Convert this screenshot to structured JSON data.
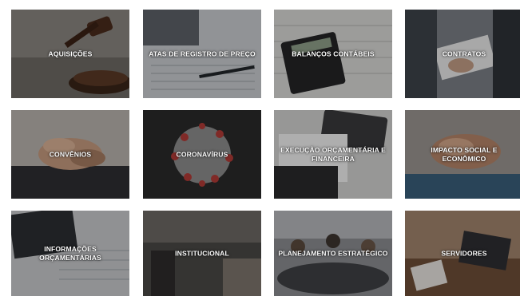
{
  "tiles": [
    {
      "label": "AQUISIÇÕES",
      "icon": "gavel-icon"
    },
    {
      "label": "ATAS DE REGISTRO DE PREÇO",
      "icon": "pen-icon"
    },
    {
      "label": "BALANÇOS CONTÁBEIS",
      "icon": "calculator-icon"
    },
    {
      "label": "CONTRATOS",
      "icon": "handshake-icon"
    },
    {
      "label": "CONVÊNIOS",
      "icon": "hands-icon"
    },
    {
      "label": "CORONAVÍRUS",
      "icon": "virus-icon"
    },
    {
      "label": "EXECUÇÃO ORÇAMENTÁRIA E FINANCEIRA",
      "icon": "calculator-icon"
    },
    {
      "label": "IMPACTO SOCIAL E ECONÔMICO",
      "icon": "hands-icon"
    },
    {
      "label": "INFORMAÇÕES ORÇAMENTÁRIAS",
      "icon": "keyboard-icon"
    },
    {
      "label": "INSTITUCIONAL",
      "icon": "office-icon"
    },
    {
      "label": "PLANEJAMENTO ESTRATÉGICO",
      "icon": "meeting-icon"
    },
    {
      "label": "SERVIDORES",
      "icon": "team-icon"
    }
  ]
}
